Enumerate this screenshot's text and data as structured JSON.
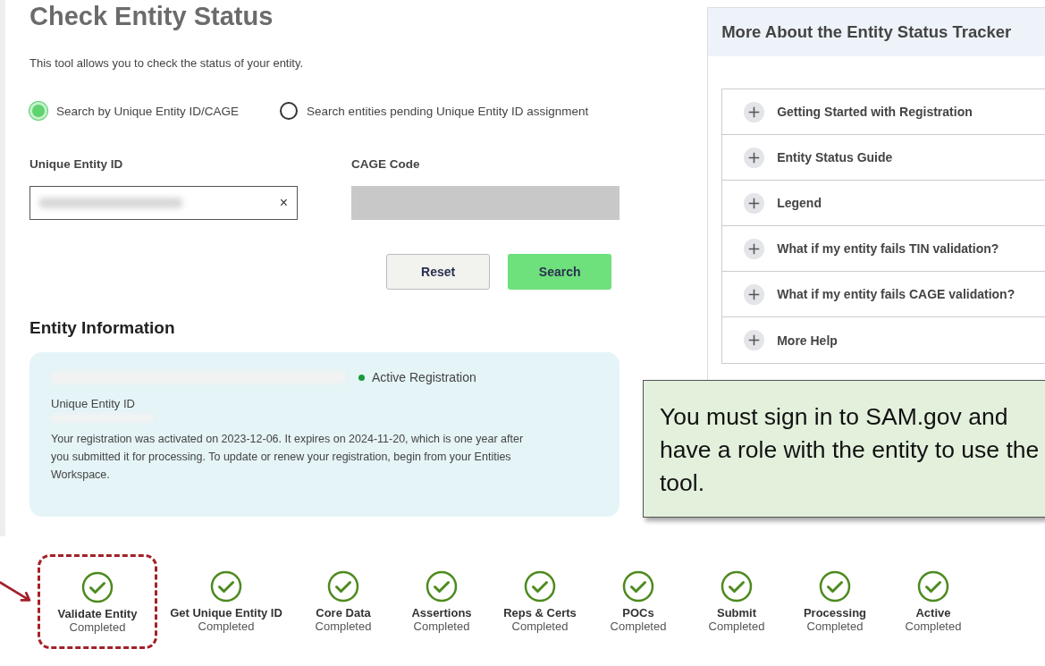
{
  "title": "Check Entity Status",
  "description": "This tool allows you to check the status of your entity.",
  "search_modes": [
    {
      "label": "Search by Unique Entity ID/CAGE",
      "selected": true
    },
    {
      "label": "Search entities pending Unique Entity ID assignment",
      "selected": false
    }
  ],
  "fields": [
    {
      "label": "Unique Entity ID",
      "disabled": false,
      "clear_icon": "×"
    },
    {
      "label": "CAGE Code",
      "disabled": true
    }
  ],
  "buttons": [
    {
      "label": "Reset",
      "kind": "secondary"
    },
    {
      "label": "Search",
      "kind": "primary"
    }
  ],
  "entity_information": {
    "heading": "Entity Information",
    "status": "Active Registration",
    "id_label": "Unique Entity ID",
    "message": "Your registration was activated on 2023-12-06. It expires on 2024-11-20, which is one year after you submitted it for processing. To update or renew your registration, begin from your Entities Workspace."
  },
  "side_panel": {
    "title": "More About the Entity Status Tracker",
    "items": [
      {
        "label": "Getting Started with Registration",
        "expanded": false
      },
      {
        "label": "Entity Status Guide",
        "expanded": false
      },
      {
        "label": "Legend",
        "expanded": false
      },
      {
        "label": "What if my entity fails TIN validation?",
        "expanded": false
      },
      {
        "label": "What if my entity fails CAGE validation?",
        "expanded": false
      },
      {
        "label": "More Help",
        "expanded": false
      }
    ]
  },
  "callout": "You must sign in to SAM.gov and have a role with the entity to use the tool.",
  "steps": [
    {
      "label": "Validate Entity",
      "status": "Completed",
      "completed": true,
      "highlighted": true
    },
    {
      "label": "Get Unique Entity ID",
      "status": "Completed",
      "completed": true,
      "highlighted": false
    },
    {
      "label": "Core Data",
      "status": "Completed",
      "completed": true,
      "highlighted": false
    },
    {
      "label": "Assertions",
      "status": "Completed",
      "completed": true,
      "highlighted": false
    },
    {
      "label": "Reps & Certs",
      "status": "Completed",
      "completed": true,
      "highlighted": false
    },
    {
      "label": "POCs",
      "status": "Completed",
      "completed": true,
      "highlighted": false
    },
    {
      "label": "Submit",
      "status": "Completed",
      "completed": true,
      "highlighted": false
    },
    {
      "label": "Processing",
      "status": "Completed",
      "completed": true,
      "highlighted": false
    },
    {
      "label": "Active",
      "status": "Completed",
      "completed": true,
      "highlighted": false
    }
  ]
}
